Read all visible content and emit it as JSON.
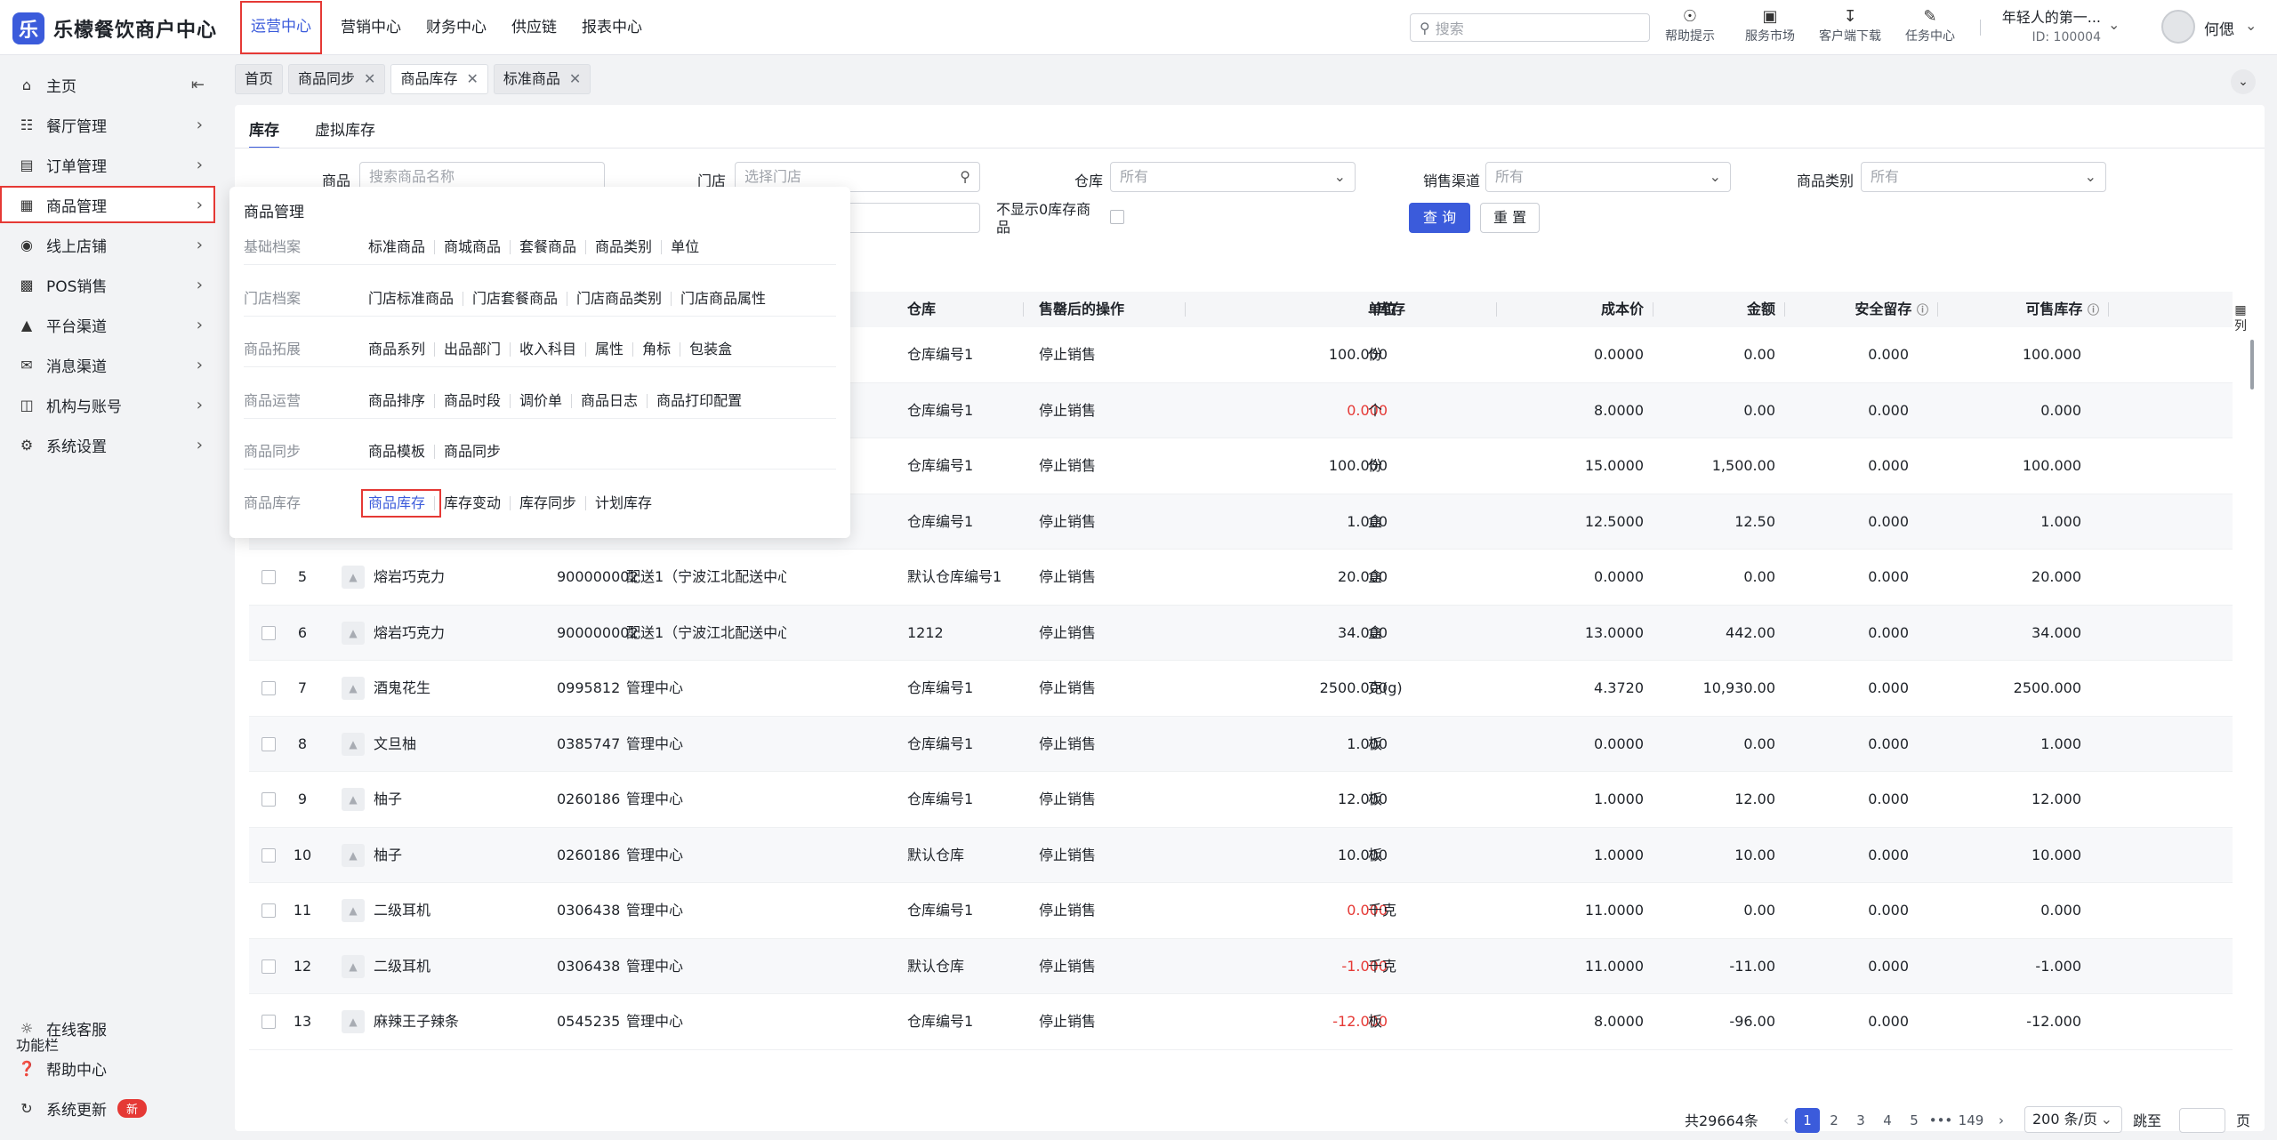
{
  "app": {
    "logo_char": "乐",
    "title": "乐檬餐饮商户中心"
  },
  "topnav": [
    "运营中心",
    "营销中心",
    "财务中心",
    "供应链",
    "报表中心"
  ],
  "search_placeholder": "搜索",
  "tools": [
    {
      "icon": "bulb-icon",
      "label": "帮助提示"
    },
    {
      "icon": "shop-icon",
      "label": "服务市场"
    },
    {
      "icon": "download-icon",
      "label": "客户端下载"
    },
    {
      "icon": "task-icon",
      "label": "任务中心"
    }
  ],
  "store": {
    "name": "年轻人的第一...",
    "id": "ID: 100004"
  },
  "user": {
    "name": "何偲"
  },
  "sidebar": {
    "items": [
      {
        "label": "主页",
        "icon": "home-icon"
      },
      {
        "label": "餐厅管理",
        "icon": "restaurant-icon"
      },
      {
        "label": "订单管理",
        "icon": "order-icon"
      },
      {
        "label": "商品管理",
        "icon": "product-icon"
      },
      {
        "label": "线上店铺",
        "icon": "online-store-icon"
      },
      {
        "label": "POS销售",
        "icon": "pos-icon"
      },
      {
        "label": "平台渠道",
        "icon": "channel-icon"
      },
      {
        "label": "消息渠道",
        "icon": "message-icon"
      },
      {
        "label": "机构与账号",
        "icon": "org-icon"
      },
      {
        "label": "系统设置",
        "icon": "settings-icon"
      }
    ],
    "func_title": "功能栏",
    "func_items": [
      {
        "label": "在线客服",
        "icon": "support-icon"
      },
      {
        "label": "帮助中心",
        "icon": "help-icon"
      },
      {
        "label": "系统更新",
        "icon": "update-icon"
      }
    ],
    "new_badge": "新"
  },
  "page_tabs": [
    "首页",
    "商品同步",
    "商品库存",
    "标准商品"
  ],
  "sub_tabs": [
    "库存",
    "虚拟库存"
  ],
  "filters": {
    "product_label": "商品",
    "product_placeholder": "搜索商品名称",
    "store_label": "门店",
    "store_placeholder": "选择门店",
    "warehouse_label": "仓库",
    "warehouse_value": "所有",
    "channel_label": "销售渠道",
    "channel_value": "所有",
    "category_label": "商品类别",
    "category_value": "所有",
    "hide_zero_label": "不显示0库存商品",
    "query_btn": "查 询",
    "reset_btn": "重 置"
  },
  "table": {
    "headers": {
      "warehouse": "仓库",
      "action": "售罄后的操作",
      "stock": "库存",
      "unit": "单位",
      "cost": "成本价",
      "amount": "金额",
      "safe": "安全留存",
      "available": "可售库存"
    },
    "col_setting": "列",
    "rows": [
      {
        "no": "",
        "name": "",
        "code": "",
        "store": "",
        "wh": "仓库编号1",
        "act": "停止销售",
        "stock": "100.000",
        "unit": "份",
        "cost": "0.0000",
        "amt": "0.00",
        "safe": "0.000",
        "avail": "100.000",
        "neg": false
      },
      {
        "no": "",
        "name": "",
        "code": "",
        "store": "",
        "wh": "仓库编号1",
        "act": "停止销售",
        "stock": "0.000",
        "unit": "个",
        "cost": "8.0000",
        "amt": "0.00",
        "safe": "0.000",
        "avail": "0.000",
        "neg": true
      },
      {
        "no": "",
        "name": "",
        "code": "",
        "store": "",
        "wh": "仓库编号1",
        "act": "停止销售",
        "stock": "100.000",
        "unit": "份",
        "cost": "15.0000",
        "amt": "1,500.00",
        "safe": "0.000",
        "avail": "100.000",
        "neg": false
      },
      {
        "no": "",
        "name": "",
        "code": "",
        "store": "",
        "wh": "仓库编号1",
        "act": "停止销售",
        "stock": "1.000",
        "unit": "盒",
        "cost": "12.5000",
        "amt": "12.50",
        "safe": "0.000",
        "avail": "1.000",
        "neg": false
      },
      {
        "no": "5",
        "name": "熔岩巧克力",
        "code": "900000002",
        "store": "配送1（宁波江北配送中心",
        "wh": "默认仓库编号1",
        "act": "停止销售",
        "stock": "20.000",
        "unit": "盒",
        "cost": "0.0000",
        "amt": "0.00",
        "safe": "0.000",
        "avail": "20.000",
        "neg": false
      },
      {
        "no": "6",
        "name": "熔岩巧克力",
        "code": "900000002",
        "store": "配送1（宁波江北配送中心",
        "wh": "1212",
        "act": "停止销售",
        "stock": "34.000",
        "unit": "盒",
        "cost": "13.0000",
        "amt": "442.00",
        "safe": "0.000",
        "avail": "34.000",
        "neg": false
      },
      {
        "no": "7",
        "name": "酒鬼花生",
        "code": "0995812",
        "store": "管理中心",
        "wh": "仓库编号1",
        "act": "停止销售",
        "stock": "2500.000",
        "unit": "克(g)",
        "cost": "4.3720",
        "amt": "10,930.00",
        "safe": "0.000",
        "avail": "2500.000",
        "neg": false
      },
      {
        "no": "8",
        "name": "文旦柚",
        "code": "0385747",
        "store": "管理中心",
        "wh": "仓库编号1",
        "act": "停止销售",
        "stock": "1.000",
        "unit": "板",
        "cost": "0.0000",
        "amt": "0.00",
        "safe": "0.000",
        "avail": "1.000",
        "neg": false
      },
      {
        "no": "9",
        "name": "柚子",
        "code": "0260186",
        "store": "管理中心",
        "wh": "仓库编号1",
        "act": "停止销售",
        "stock": "12.000",
        "unit": "板",
        "cost": "1.0000",
        "amt": "12.00",
        "safe": "0.000",
        "avail": "12.000",
        "neg": false
      },
      {
        "no": "10",
        "name": "柚子",
        "code": "0260186",
        "store": "管理中心",
        "wh": "默认仓库",
        "act": "停止销售",
        "stock": "10.000",
        "unit": "板",
        "cost": "1.0000",
        "amt": "10.00",
        "safe": "0.000",
        "avail": "10.000",
        "neg": false
      },
      {
        "no": "11",
        "name": "二级耳机",
        "code": "0306438",
        "store": "管理中心",
        "wh": "仓库编号1",
        "act": "停止销售",
        "stock": "0.000",
        "unit": "千克",
        "cost": "11.0000",
        "amt": "0.00",
        "safe": "0.000",
        "avail": "0.000",
        "neg": true
      },
      {
        "no": "12",
        "name": "二级耳机",
        "code": "0306438",
        "store": "管理中心",
        "wh": "默认仓库",
        "act": "停止销售",
        "stock": "-1.000",
        "unit": "千克",
        "cost": "11.0000",
        "amt": "-11.00",
        "safe": "0.000",
        "avail": "-1.000",
        "neg": true
      },
      {
        "no": "13",
        "name": "麻辣王子辣条",
        "code": "0545235",
        "store": "管理中心",
        "wh": "仓库编号1",
        "act": "停止销售",
        "stock": "-12.000",
        "unit": "板",
        "cost": "8.0000",
        "amt": "-96.00",
        "safe": "0.000",
        "avail": "-12.000",
        "neg": true
      }
    ]
  },
  "pagination": {
    "total": "共29664条",
    "pages": [
      "1",
      "2",
      "3",
      "4",
      "5",
      "•••",
      "149"
    ],
    "page_size": "200 条/页",
    "jump_label": "跳至",
    "page_suffix": "页"
  },
  "mega_menu": {
    "title": "商品管理",
    "groups": [
      {
        "cat": "基础档案",
        "links": [
          "标准商品",
          "商城商品",
          "套餐商品",
          "商品类别",
          "单位"
        ]
      },
      {
        "cat": "门店档案",
        "links": [
          "门店标准商品",
          "门店套餐商品",
          "门店商品类别",
          "门店商品属性"
        ]
      },
      {
        "cat": "商品拓展",
        "links": [
          "商品系列",
          "出品部门",
          "收入科目",
          "属性",
          "角标",
          "包装盒"
        ]
      },
      {
        "cat": "商品运营",
        "links": [
          "商品排序",
          "商品时段",
          "调价单",
          "商品日志",
          "商品打印配置"
        ]
      },
      {
        "cat": "商品同步",
        "links": [
          "商品模板",
          "商品同步"
        ]
      },
      {
        "cat": "商品库存",
        "links": [
          "商品库存",
          "库存变动",
          "库存同步",
          "计划库存"
        ]
      }
    ]
  },
  "colors": {
    "accent": "#3b5bdb",
    "highlight": "#e53935",
    "negative": "#e53935"
  }
}
